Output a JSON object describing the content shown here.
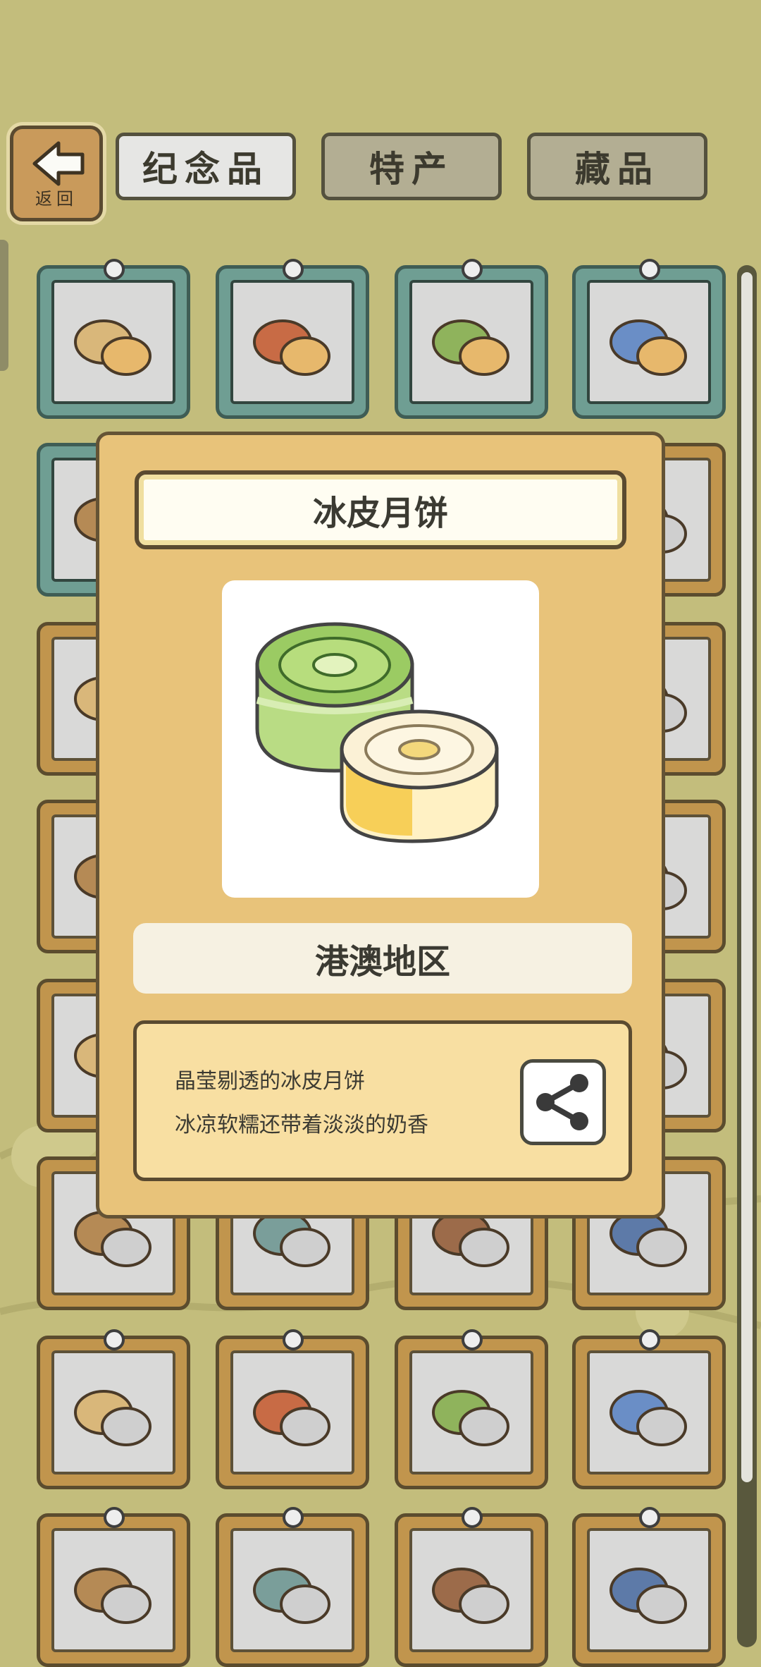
{
  "back_button": {
    "label": "返回",
    "icon": "left-arrow-icon"
  },
  "tabs": [
    {
      "label": "纪念品",
      "active": true
    },
    {
      "label": "特产",
      "active": false
    },
    {
      "label": "藏品",
      "active": false
    }
  ],
  "item_detail": {
    "name": "冰皮月饼",
    "region": "港澳地区",
    "description_lines": [
      "晶莹剔透的冰皮月饼",
      "冰凉软糯还带着淡淡的奶香"
    ],
    "share_icon": "share-icon"
  },
  "grid_items": [
    "ring-mooncake",
    "red-seal-mooncake",
    "cantonese-mooncake",
    "egg-yolk-mooncake",
    "snowskin-mooncake",
    "",
    "",
    "clock-figure",
    "red-figure",
    "",
    "",
    "rooster-figure",
    "red-vase",
    "",
    "",
    "blue-vase",
    "green-dish",
    "",
    "",
    "blue-white-porcelain",
    "prayer-beads",
    "chime-bells",
    "stone-turtle",
    "stone-figure",
    "tang-horse",
    "jade-cup",
    "chinese-knot",
    "pocket-watch",
    "double-decker-bus",
    "bronze-bell",
    "silver-necklace",
    "blue-bowl"
  ],
  "colors": {
    "background": "#c3bd7c",
    "overlay": "#e8c37a",
    "card_wood": "#c1954d",
    "card_teal": "#6f9e93"
  }
}
